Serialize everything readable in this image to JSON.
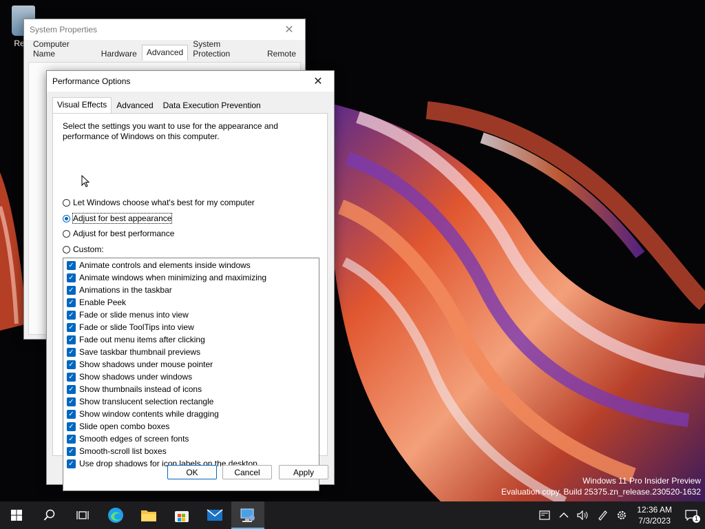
{
  "desktop": {
    "icon_label": "Recy",
    "watermark_line1": "Windows 11 Pro Insider Preview",
    "watermark_line2": "Evaluation copy. Build 25375.zn_release.230520-1632"
  },
  "system_properties": {
    "title": "System Properties",
    "tabs": [
      "Computer Name",
      "Hardware",
      "Advanced",
      "System Protection",
      "Remote"
    ],
    "active_tab": "Advanced"
  },
  "performance_options": {
    "title": "Performance Options",
    "tabs": [
      "Visual Effects",
      "Advanced",
      "Data Execution Prevention"
    ],
    "active_tab": "Visual Effects",
    "description": "Select the settings you want to use for the appearance and performance of Windows on this computer.",
    "radios": [
      {
        "label": "Let Windows choose what's best for my computer",
        "checked": false
      },
      {
        "label": "Adjust for best appearance",
        "checked": true
      },
      {
        "label": "Adjust for best performance",
        "checked": false
      },
      {
        "label": "Custom:",
        "checked": false
      }
    ],
    "effects": [
      {
        "label": "Animate controls and elements inside windows",
        "checked": true
      },
      {
        "label": "Animate windows when minimizing and maximizing",
        "checked": true
      },
      {
        "label": "Animations in the taskbar",
        "checked": true
      },
      {
        "label": "Enable Peek",
        "checked": true
      },
      {
        "label": "Fade or slide menus into view",
        "checked": true
      },
      {
        "label": "Fade or slide ToolTips into view",
        "checked": true
      },
      {
        "label": "Fade out menu items after clicking",
        "checked": true
      },
      {
        "label": "Save taskbar thumbnail previews",
        "checked": true
      },
      {
        "label": "Show shadows under mouse pointer",
        "checked": true
      },
      {
        "label": "Show shadows under windows",
        "checked": true
      },
      {
        "label": "Show thumbnails instead of icons",
        "checked": true
      },
      {
        "label": "Show translucent selection rectangle",
        "checked": true
      },
      {
        "label": "Show window contents while dragging",
        "checked": true
      },
      {
        "label": "Slide open combo boxes",
        "checked": true
      },
      {
        "label": "Smooth edges of screen fonts",
        "checked": true
      },
      {
        "label": "Smooth-scroll list boxes",
        "checked": true
      },
      {
        "label": "Use drop shadows for icon labels on the desktop",
        "checked": true
      }
    ],
    "buttons": {
      "ok": "OK",
      "cancel": "Cancel",
      "apply": "Apply"
    }
  },
  "taskbar": {
    "apps": [
      "start-icon",
      "search-icon",
      "task-view-icon",
      "edge-icon",
      "file-explorer-icon",
      "store-icon",
      "mail-icon",
      "system-properties-icon"
    ],
    "clock_time": "12:36 AM",
    "clock_date": "7/3/2023",
    "notification_count": "1"
  },
  "colors": {
    "accent": "#0067c0",
    "taskbar": "#1d1d1f",
    "wallpaper_dark": "#050406"
  }
}
